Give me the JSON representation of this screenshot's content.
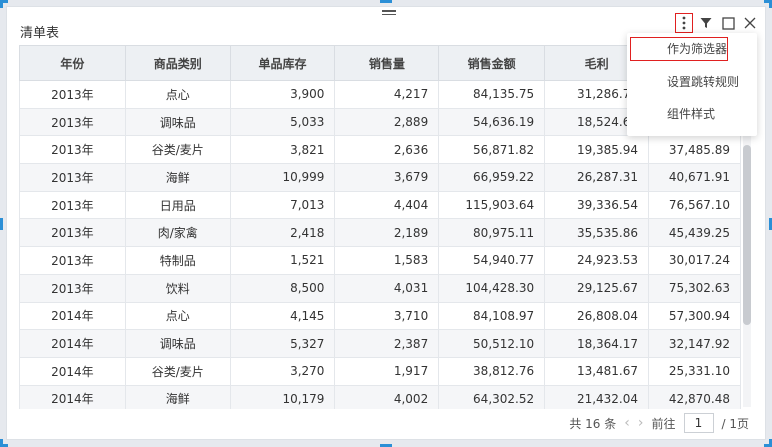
{
  "widget": {
    "title": "清单表"
  },
  "toolbar": {
    "more_icon": "more-vertical-icon",
    "filter_icon": "filter-icon",
    "maximize_icon": "maximize-icon",
    "close_icon": "close-icon"
  },
  "menu": {
    "items": [
      {
        "label": "作为筛选器"
      },
      {
        "label": "设置跳转规则"
      },
      {
        "label": "组件样式"
      }
    ]
  },
  "table": {
    "columns": [
      "年份",
      "商品类别",
      "单品库存",
      "销售量",
      "销售金额",
      "毛利",
      ""
    ],
    "rows": [
      [
        "2013年",
        "点心",
        "3,900",
        "4,217",
        "84,135.75",
        "31,286.73",
        ""
      ],
      [
        "2013年",
        "调味品",
        "5,033",
        "2,889",
        "54,636.19",
        "18,524.64",
        ""
      ],
      [
        "2013年",
        "谷类/麦片",
        "3,821",
        "2,636",
        "56,871.82",
        "19,385.94",
        "37,485.89"
      ],
      [
        "2013年",
        "海鲜",
        "10,999",
        "3,679",
        "66,959.22",
        "26,287.31",
        "40,671.91"
      ],
      [
        "2013年",
        "日用品",
        "7,013",
        "4,404",
        "115,903.64",
        "39,336.54",
        "76,567.10"
      ],
      [
        "2013年",
        "肉/家禽",
        "2,418",
        "2,189",
        "80,975.11",
        "35,535.86",
        "45,439.25"
      ],
      [
        "2013年",
        "特制品",
        "1,521",
        "1,583",
        "54,940.77",
        "24,923.53",
        "30,017.24"
      ],
      [
        "2013年",
        "饮料",
        "8,500",
        "4,031",
        "104,428.30",
        "29,125.67",
        "75,302.63"
      ],
      [
        "2014年",
        "点心",
        "4,145",
        "3,710",
        "84,108.97",
        "26,808.04",
        "57,300.94"
      ],
      [
        "2014年",
        "调味品",
        "5,327",
        "2,387",
        "50,512.10",
        "18,364.17",
        "32,147.92"
      ],
      [
        "2014年",
        "谷类/麦片",
        "3,270",
        "1,917",
        "38,812.76",
        "13,481.67",
        "25,331.10"
      ],
      [
        "2014年",
        "海鲜",
        "10,179",
        "4,002",
        "64,302.52",
        "21,432.04",
        "42,870.48"
      ]
    ]
  },
  "pager": {
    "total": "共 16 条",
    "goto_label": "前往",
    "page": "1",
    "pages": "/ 1页"
  },
  "colors": {
    "selection": "#2b8fd6",
    "highlight": "#e02020",
    "header_bg": "#edf0f3"
  }
}
